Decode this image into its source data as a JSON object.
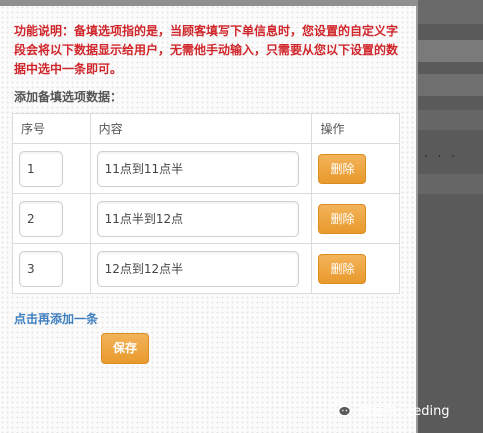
{
  "notice": "功能说明：备填选项指的是，当顾客填写下单信息时，您设置的自定义字段会将以下数据显示给用户，无需他手动输入，只需要从您以下设置的数据中选中一条即可。",
  "section_label": "添加备填选项数据：",
  "table": {
    "headers": [
      "序号",
      "内容",
      "操作"
    ],
    "rows": [
      {
        "no": "1",
        "content": "11点到11点半",
        "action": "删除"
      },
      {
        "no": "2",
        "content": "11点半到12点",
        "action": "删除"
      },
      {
        "no": "3",
        "content": "12点到12点半",
        "action": "删除"
      }
    ]
  },
  "add_link": "点击再添加一条",
  "save_label": "保存",
  "background_dots": ". . .",
  "watermark": {
    "text": "微信号: veding",
    "icon": "wechat-icon"
  },
  "colors": {
    "notice": "#d0262b",
    "button": "#e89a2c",
    "link": "#3f7fbf"
  }
}
